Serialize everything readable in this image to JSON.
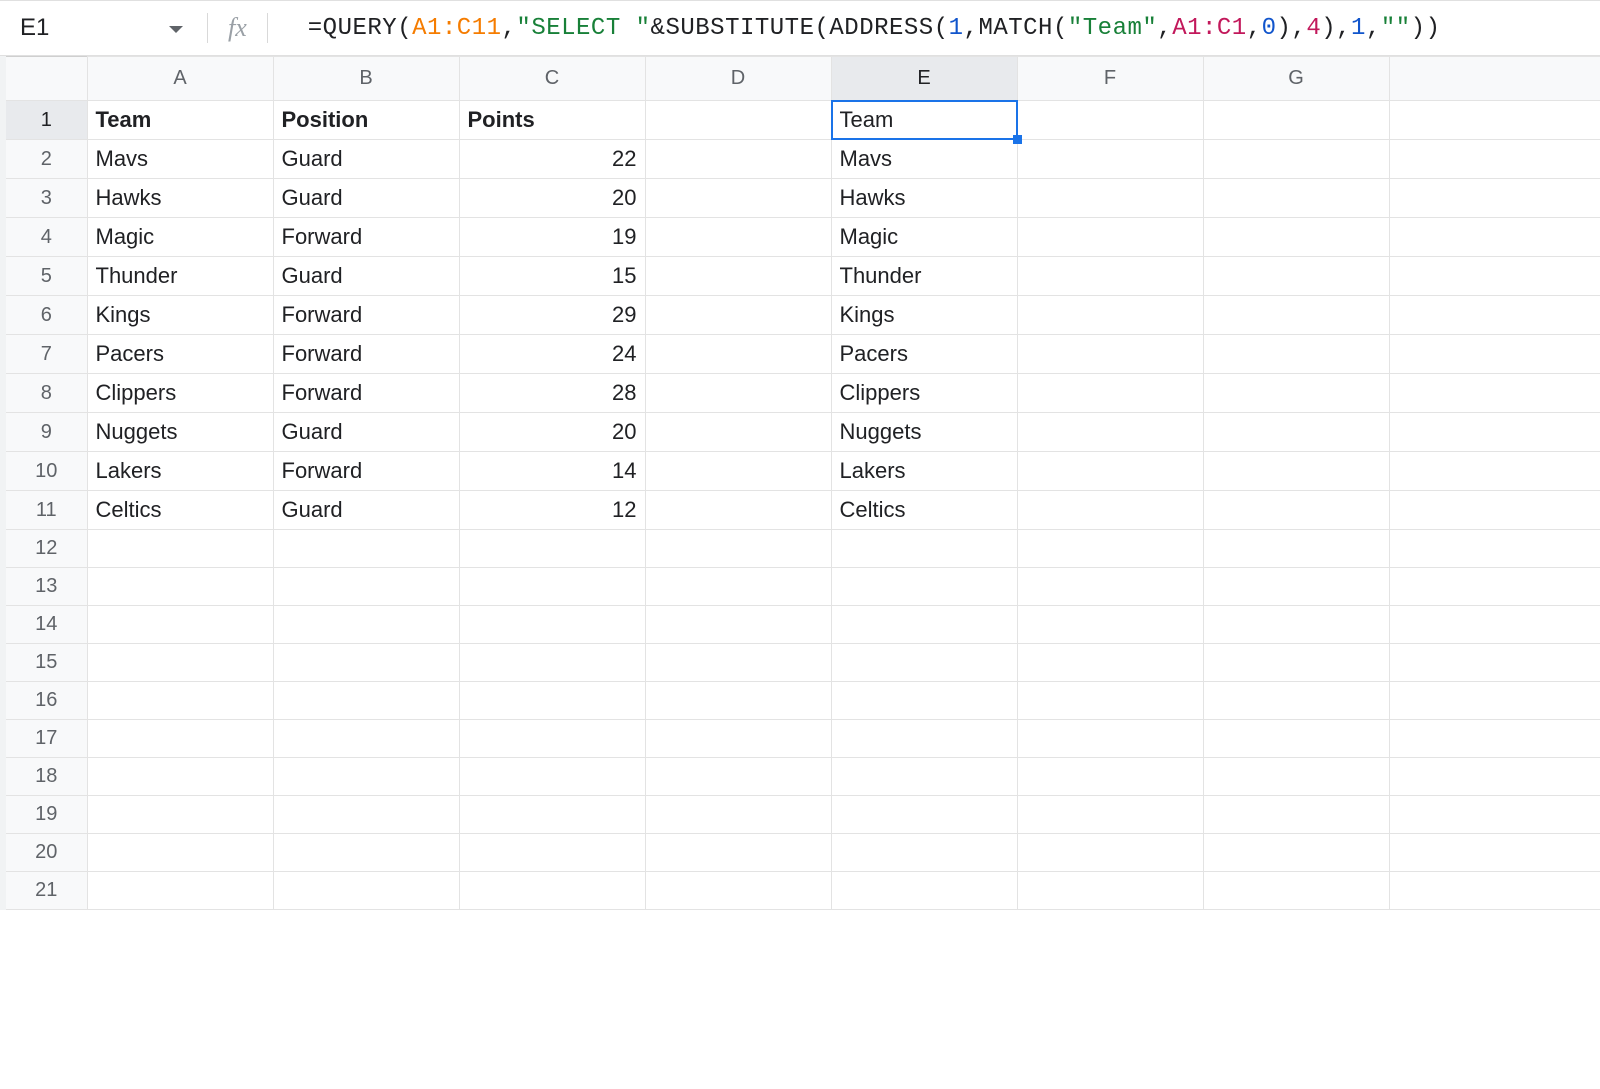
{
  "name_box": "E1",
  "formula": {
    "prefix": "=",
    "tokens": [
      {
        "t": "QUERY",
        "cls": "tok-func"
      },
      {
        "t": "(",
        "cls": "tok-p"
      },
      {
        "t": "A1:C11",
        "cls": "tok-range"
      },
      {
        "t": ",",
        "cls": "tok-p"
      },
      {
        "t": "\"SELECT \"",
        "cls": "tok-string"
      },
      {
        "t": "&",
        "cls": "tok-p"
      },
      {
        "t": "SUBSTITUTE",
        "cls": "tok-func"
      },
      {
        "t": "(",
        "cls": "tok-p"
      },
      {
        "t": "ADDRESS",
        "cls": "tok-func"
      },
      {
        "t": "(",
        "cls": "tok-p"
      },
      {
        "t": "1",
        "cls": "tok-num1"
      },
      {
        "t": ",",
        "cls": "tok-p"
      },
      {
        "t": "MATCH",
        "cls": "tok-func"
      },
      {
        "t": "(",
        "cls": "tok-p"
      },
      {
        "t": "\"Team\"",
        "cls": "tok-string"
      },
      {
        "t": ",",
        "cls": "tok-p"
      },
      {
        "t": "A1:C1",
        "cls": "tok-range2"
      },
      {
        "t": ",",
        "cls": "tok-p"
      },
      {
        "t": "0",
        "cls": "tok-num0"
      },
      {
        "t": ")",
        "cls": "tok-p"
      },
      {
        "t": ",",
        "cls": "tok-p"
      },
      {
        "t": "4",
        "cls": "tok-num4"
      },
      {
        "t": ")",
        "cls": "tok-p"
      },
      {
        "t": ",",
        "cls": "tok-p"
      },
      {
        "t": "1",
        "cls": "tok-num1"
      },
      {
        "t": ",",
        "cls": "tok-p"
      },
      {
        "t": "\"\"",
        "cls": "tok-string"
      },
      {
        "t": ")",
        "cls": "tok-p"
      },
      {
        "t": ")",
        "cls": "tok-p"
      }
    ]
  },
  "columns": [
    "A",
    "B",
    "C",
    "D",
    "E",
    "F",
    "G"
  ],
  "active_cell": {
    "col": "E",
    "row": 1
  },
  "row_count": 21,
  "cells": {
    "A1": {
      "v": "Team",
      "bold": true
    },
    "B1": {
      "v": "Position",
      "bold": true
    },
    "C1": {
      "v": "Points",
      "bold": true
    },
    "E1": {
      "v": "Team"
    },
    "A2": {
      "v": "Mavs"
    },
    "B2": {
      "v": "Guard"
    },
    "C2": {
      "v": "22",
      "num": true
    },
    "E2": {
      "v": "Mavs"
    },
    "A3": {
      "v": "Hawks"
    },
    "B3": {
      "v": "Guard"
    },
    "C3": {
      "v": "20",
      "num": true
    },
    "E3": {
      "v": "Hawks"
    },
    "A4": {
      "v": "Magic"
    },
    "B4": {
      "v": "Forward"
    },
    "C4": {
      "v": "19",
      "num": true
    },
    "E4": {
      "v": "Magic"
    },
    "A5": {
      "v": "Thunder"
    },
    "B5": {
      "v": "Guard"
    },
    "C5": {
      "v": "15",
      "num": true
    },
    "E5": {
      "v": "Thunder"
    },
    "A6": {
      "v": "Kings"
    },
    "B6": {
      "v": "Forward"
    },
    "C6": {
      "v": "29",
      "num": true
    },
    "E6": {
      "v": "Kings"
    },
    "A7": {
      "v": "Pacers"
    },
    "B7": {
      "v": "Forward"
    },
    "C7": {
      "v": "24",
      "num": true
    },
    "E7": {
      "v": "Pacers"
    },
    "A8": {
      "v": "Clippers"
    },
    "B8": {
      "v": "Forward"
    },
    "C8": {
      "v": "28",
      "num": true
    },
    "E8": {
      "v": "Clippers"
    },
    "A9": {
      "v": "Nuggets"
    },
    "B9": {
      "v": "Guard"
    },
    "C9": {
      "v": "20",
      "num": true
    },
    "E9": {
      "v": "Nuggets"
    },
    "A10": {
      "v": "Lakers"
    },
    "B10": {
      "v": "Forward"
    },
    "C10": {
      "v": "14",
      "num": true
    },
    "E10": {
      "v": "Lakers"
    },
    "A11": {
      "v": "Celtics"
    },
    "B11": {
      "v": "Guard"
    },
    "C11": {
      "v": "12",
      "num": true
    },
    "E11": {
      "v": "Celtics"
    }
  }
}
